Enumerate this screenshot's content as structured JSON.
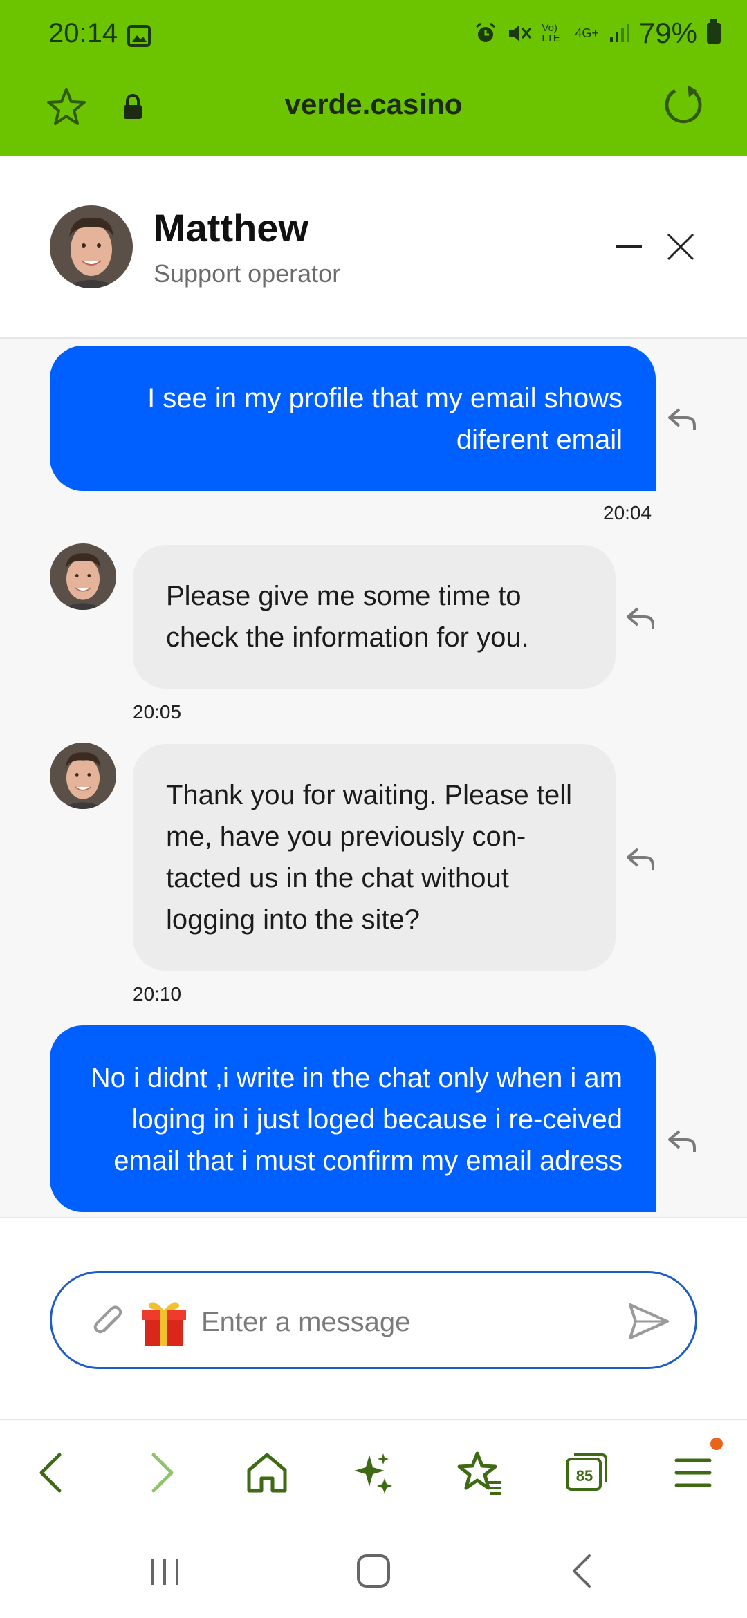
{
  "status_bar": {
    "time": "20:14",
    "battery": "79%",
    "network": "4G+",
    "volte": "Vo) LTE"
  },
  "browser": {
    "url": "verde.casino",
    "tabs_count": "85",
    "accent_color": "#6cc400"
  },
  "chat": {
    "agent_name": "Matthew",
    "agent_role": "Support operator",
    "messages": [
      {
        "from": "user",
        "text": "I see in my profile that my email shows diferent email",
        "time": "20:04"
      },
      {
        "from": "agent",
        "text": "Please give me some time to check the information for you.",
        "time": "20:05"
      },
      {
        "from": "agent",
        "text": "Thank you for waiting. Please tell me, have you previously con-tacted us in the chat without logging into the site?",
        "time": "20:10"
      },
      {
        "from": "user",
        "text": "No i didnt ,i write in the chat only when i am loging in i just loged because i re-ceived email that i must confirm my email adress",
        "time": ""
      }
    ],
    "input_placeholder": "Enter a message",
    "user_bubble_color": "#0060ff"
  }
}
